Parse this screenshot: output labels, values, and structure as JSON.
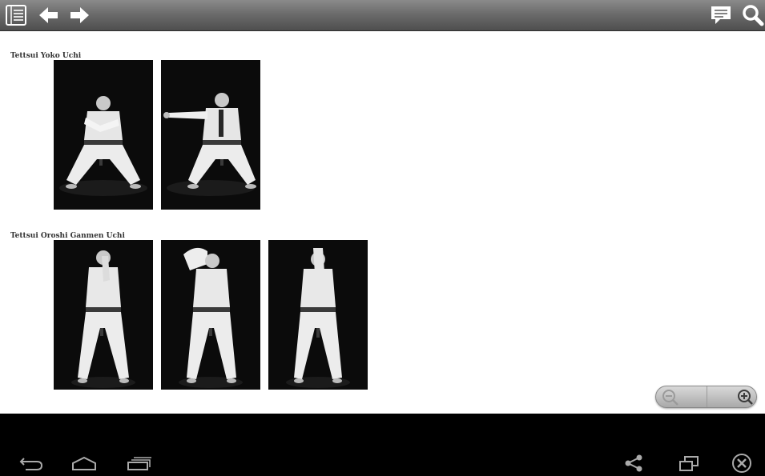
{
  "toolbar": {
    "icons": [
      "table-of-contents-icon",
      "back-arrow-icon",
      "forward-arrow-icon",
      "comment-icon",
      "search-icon"
    ]
  },
  "sections": [
    {
      "title": "Tettsui Yoko Uchi",
      "photo_count": 2
    },
    {
      "title": "Tettsui Oroshi Ganmen Uchi",
      "photo_count": 3
    }
  ],
  "zoom": {
    "icons": [
      "zoom-out-icon",
      "zoom-in-icon"
    ]
  },
  "navbar": {
    "icons": [
      "back-icon",
      "home-icon",
      "recent-apps-icon",
      "share-icon",
      "window-icon",
      "close-icon"
    ]
  },
  "colors": {
    "toolbar_top": "#8a8a8a",
    "toolbar_bottom": "#4e4e4e",
    "page_bg": "#ffffff",
    "nav_bg": "#000000"
  }
}
